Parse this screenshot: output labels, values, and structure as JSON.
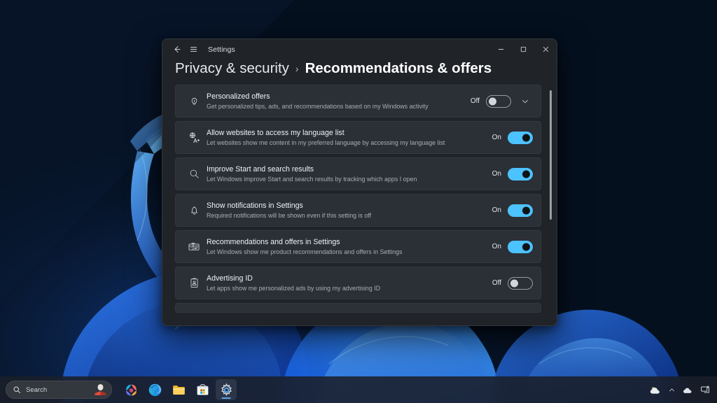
{
  "window": {
    "app_title": "Settings",
    "back_icon": "back-arrow-icon",
    "menu_icon": "hamburger-menu-icon",
    "minimize_label": "Minimize",
    "maximize_label": "Maximize",
    "close_label": "Close"
  },
  "breadcrumb": {
    "parent": "Privacy & security",
    "separator": "›",
    "current": "Recommendations & offers"
  },
  "settings": [
    {
      "icon": "lightbulb-icon",
      "title": "Personalized offers",
      "description": "Get personalized tips, ads, and recommendations based on my Windows activity",
      "state_label": "Off",
      "state": "off",
      "has_expander": true
    },
    {
      "icon": "language-globe-icon",
      "title": "Allow websites to access my language list",
      "description": "Let websites show me content in my preferred language by accessing my language list",
      "state_label": "On",
      "state": "on",
      "has_expander": false
    },
    {
      "icon": "search-icon",
      "title": "Improve Start and search results",
      "description": "Let Windows improve Start and search results by tracking which apps I open",
      "state_label": "On",
      "state": "on",
      "has_expander": false
    },
    {
      "icon": "bell-icon",
      "title": "Show notifications in Settings",
      "description": "Required notifications will be shown even if this setting is off",
      "state_label": "On",
      "state": "on",
      "has_expander": false
    },
    {
      "icon": "gift-card-icon",
      "title": "Recommendations and offers in Settings",
      "description": "Let Windows show me product recommendations and offers in Settings",
      "state_label": "On",
      "state": "on",
      "has_expander": false
    },
    {
      "icon": "advertising-id-badge-icon",
      "title": "Advertising ID",
      "description": "Let apps show me personalized ads by using my advertising ID",
      "state_label": "Off",
      "state": "off",
      "has_expander": false
    }
  ],
  "taskbar": {
    "search_placeholder": "Search",
    "search_icon": "search-icon",
    "search_avatar_icon": "person-reading-avatar-icon",
    "apps": [
      {
        "name": "copilot-icon",
        "label": "Copilot",
        "active": false
      },
      {
        "name": "edge-icon",
        "label": "Microsoft Edge",
        "active": false
      },
      {
        "name": "file-explorer-icon",
        "label": "File Explorer",
        "active": false
      },
      {
        "name": "microsoft-store-icon",
        "label": "Microsoft Store",
        "active": false
      },
      {
        "name": "settings-gear-icon",
        "label": "Settings",
        "active": true
      }
    ],
    "tray": [
      {
        "name": "weather-cloud-icon",
        "label": "Weather"
      },
      {
        "name": "show-hidden-icons-chevron-icon",
        "label": "Show hidden icons"
      },
      {
        "name": "onedrive-cloud-icon",
        "label": "OneDrive"
      },
      {
        "name": "network-icon",
        "label": "Network"
      }
    ]
  },
  "colors": {
    "accent": "#4cc2ff",
    "card_bg": "#2b2f36",
    "window_bg": "#202328",
    "taskbar_active_underline": "#5aa9f0"
  }
}
